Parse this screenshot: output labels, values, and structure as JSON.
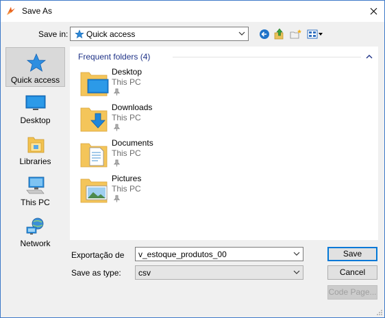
{
  "window": {
    "title": "Save As",
    "close_glyph": "✕"
  },
  "toolbar": {
    "save_in_label": "Save in:",
    "save_in_value": "Quick access",
    "back_icon": "back-arrow-icon",
    "up_icon": "up-folder-icon",
    "new_folder_icon": "new-folder-icon",
    "view_icon": "view-menu-icon"
  },
  "places": [
    {
      "label": "Quick access",
      "icon": "star-icon",
      "active": true
    },
    {
      "label": "Desktop",
      "icon": "desktop-icon"
    },
    {
      "label": "Libraries",
      "icon": "libraries-icon"
    },
    {
      "label": "This PC",
      "icon": "computer-icon"
    },
    {
      "label": "Network",
      "icon": "network-icon"
    }
  ],
  "group": {
    "title": "Frequent folders (4)"
  },
  "folders": [
    {
      "name": "Desktop",
      "location": "This PC",
      "icon": "desktop-folder-icon"
    },
    {
      "name": "Downloads",
      "location": "This PC",
      "icon": "downloads-folder-icon"
    },
    {
      "name": "Documents",
      "location": "This PC",
      "icon": "documents-folder-icon"
    },
    {
      "name": "Pictures",
      "location": "This PC",
      "icon": "pictures-folder-icon"
    }
  ],
  "form": {
    "filename_label": "Exportação de",
    "filename_value": "v_estoque_produtos_00",
    "type_label": "Save as type:",
    "type_value": "csv"
  },
  "buttons": {
    "save": "Save",
    "cancel": "Cancel",
    "code_page": "Code Page..."
  },
  "colors": {
    "accent": "#0078d7",
    "group_heading": "#1e3287",
    "window_border": "#3c78c8"
  }
}
